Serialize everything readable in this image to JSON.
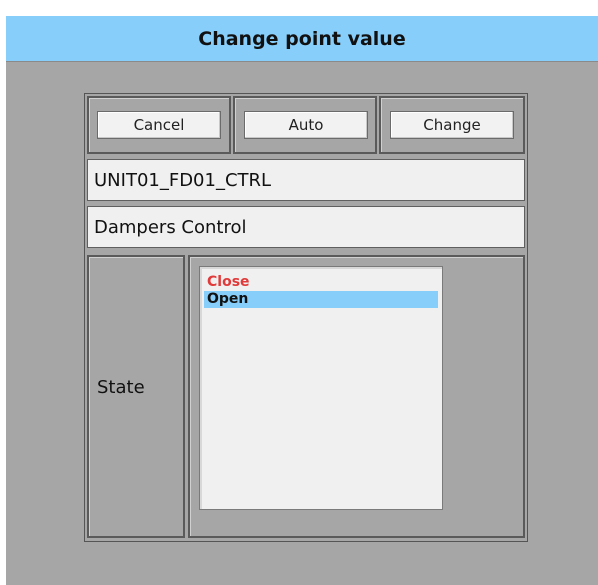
{
  "dialog": {
    "title": "Change point value"
  },
  "buttons": {
    "cancel": "Cancel",
    "auto": "Auto",
    "change": "Change"
  },
  "point": {
    "name": "UNIT01_FD01_CTRL",
    "description": "Dampers Control"
  },
  "state": {
    "label": "State",
    "options": [
      "Close",
      "Open"
    ],
    "selected": "Open"
  },
  "colors": {
    "title_bar": "#87cefa",
    "dialog_bg": "#a6a6a6",
    "close_option": "#e03a3a",
    "selected_row": "#87cefa"
  }
}
